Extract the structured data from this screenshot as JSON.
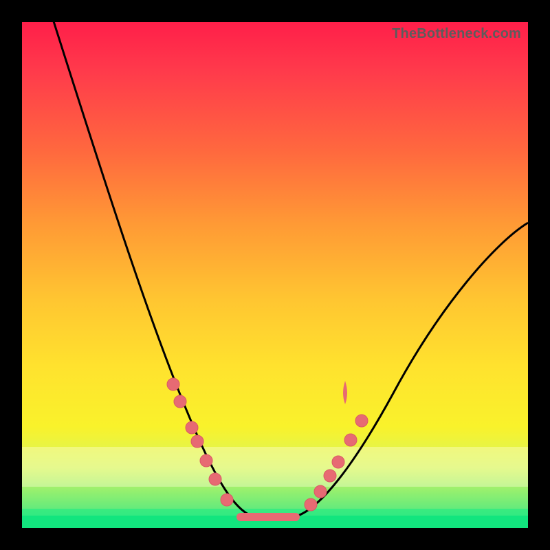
{
  "watermark": "TheBottleneck.com",
  "colors": {
    "gradient_top": "#ff1f4a",
    "gradient_bottom": "#2fe58a",
    "dot": "#e76a73",
    "curve": "#000000",
    "frame": "#000000"
  },
  "chart_data": {
    "type": "line",
    "title": "",
    "xlabel": "",
    "ylabel": "",
    "xlim": [
      0,
      100
    ],
    "ylim": [
      0,
      100
    ],
    "series": [
      {
        "name": "bottleneck-curve",
        "x": [
          0,
          5,
          10,
          15,
          20,
          25,
          30,
          35,
          40,
          44,
          48,
          52,
          55,
          60,
          65,
          70,
          75,
          80,
          85,
          90,
          95,
          100
        ],
        "y": [
          100,
          90,
          78,
          66,
          55,
          44,
          33,
          23,
          13,
          6,
          2,
          2,
          4,
          9,
          16,
          24,
          31,
          38,
          45,
          51,
          56,
          60
        ]
      }
    ],
    "markers": {
      "name": "highlight-dots",
      "x": [
        26,
        27.5,
        30,
        31,
        33,
        35,
        38,
        55,
        57,
        59,
        60.5,
        63,
        65,
        62
      ],
      "y": [
        38,
        34,
        28,
        25,
        20,
        16,
        10,
        5,
        8,
        12,
        15,
        20,
        24,
        31
      ]
    },
    "valley_flat": {
      "x0": 40,
      "x1": 52,
      "y": 2
    }
  }
}
